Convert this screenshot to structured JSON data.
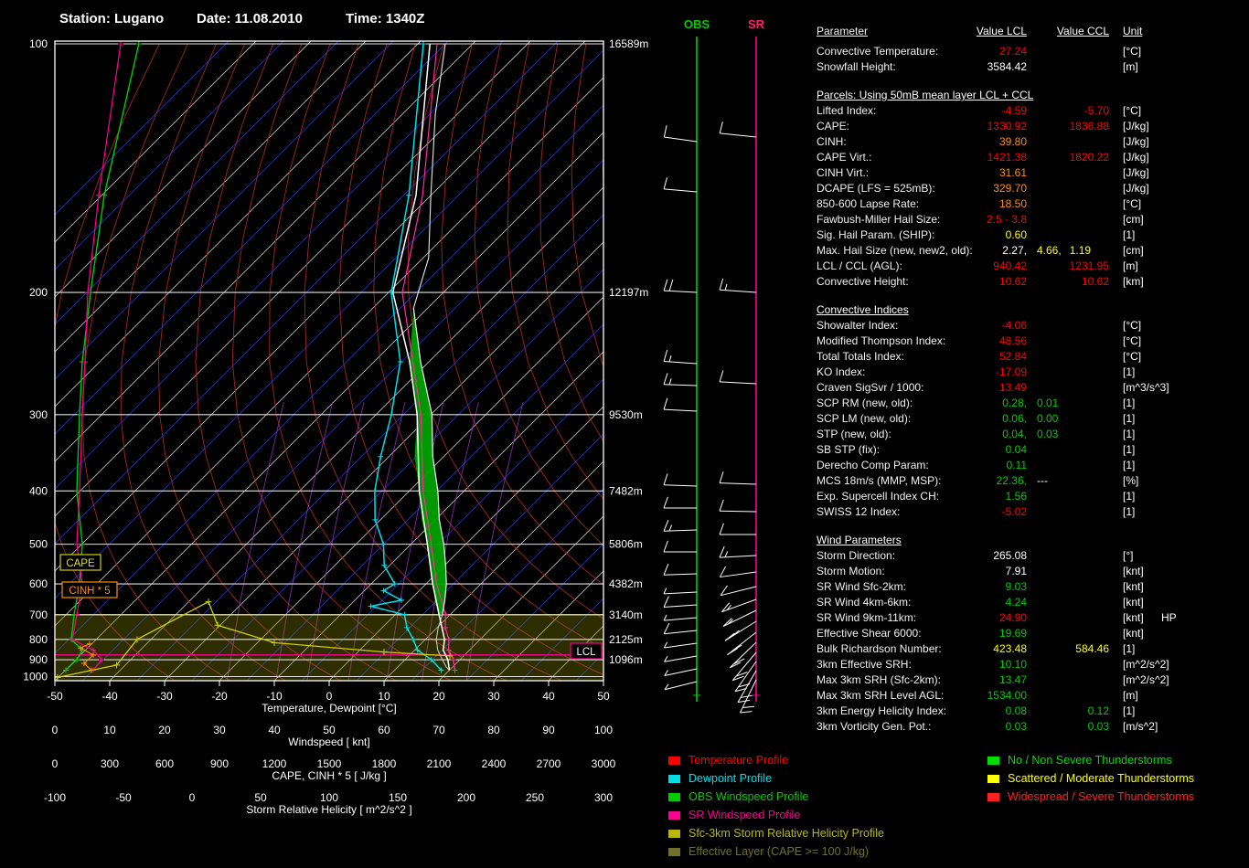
{
  "header": {
    "station": "Station: Lugano",
    "date": "Date: 11.08.2010",
    "time": "Time: 1340Z"
  },
  "obs_label": "OBS",
  "sr_label": "SR",
  "colors": {
    "red": "#ff0000",
    "orange": "#ff8c00",
    "yellow": "#ffff00",
    "green": "#00cc00",
    "white": "#ffffff",
    "cyan": "#00dde8",
    "magenta": "#ff0090",
    "lime": "#00cc00",
    "dark_yellow": "#b8b800",
    "olive": "#70702a"
  },
  "chart_data": {
    "type": "line",
    "title": "Skew-T log-P sounding",
    "pressure_ticks": [
      100,
      200,
      300,
      400,
      500,
      600,
      700,
      800,
      900,
      1000
    ],
    "height_labels": [
      "16589m",
      "12197m",
      "9530m",
      "7482m",
      "5806m",
      "4382m",
      "3140m",
      "2125m",
      "1096m"
    ],
    "temp_axis": {
      "label": "Temperature, Dewpoint [°C]",
      "ticks": [
        -50,
        -40,
        -30,
        -20,
        -10,
        0,
        10,
        20,
        30,
        40,
        50
      ],
      "range": [
        -50,
        50
      ]
    },
    "wind_axis": {
      "label": "Windspeed [ knt]",
      "ticks": [
        0,
        10,
        20,
        30,
        40,
        50,
        60,
        70,
        80,
        90,
        100
      ],
      "range": [
        0,
        100
      ]
    },
    "cape_axis": {
      "label": "CAPE, CINH * 5 [ J/kg ]",
      "ticks": [
        0,
        300,
        600,
        900,
        1200,
        1500,
        1800,
        2100,
        2400,
        2700,
        3000
      ],
      "range": [
        0,
        3000
      ]
    },
    "srh_axis": {
      "label": "Storm Relative Helicity [ m^2/s^2 ]",
      "ticks": [
        -100,
        -50,
        0,
        50,
        100,
        150,
        200,
        250,
        300
      ],
      "range": [
        -100,
        300
      ]
    },
    "labels": {
      "cape": "CAPE",
      "cinh": "CINH * 5",
      "lcl": "LCL"
    },
    "lcl_pressure": 875,
    "effective_layer": {
      "top_p": 700,
      "bottom_p": 1000
    },
    "mixing_ratio_tdew": [
      -18.6,
      -9.7,
      -4,
      3.5,
      10.5,
      16.9,
      25
    ],
    "series": {
      "temperature": [
        [
          960,
          20
        ],
        [
          900,
          17.8
        ],
        [
          850,
          15.2
        ],
        [
          800,
          13.5
        ],
        [
          700,
          8
        ],
        [
          600,
          1.2
        ],
        [
          500,
          -7
        ],
        [
          400,
          -18.2
        ],
        [
          300,
          -32.5
        ],
        [
          250,
          -43.5
        ],
        [
          200,
          -59.2
        ],
        [
          150,
          -72.7
        ],
        [
          100,
          -97.8
        ]
      ],
      "dewpoint": [
        [
          960,
          18.5
        ],
        [
          900,
          14.8
        ],
        [
          850,
          10.5
        ],
        [
          800,
          7.8
        ],
        [
          750,
          4.5
        ],
        [
          700,
          1.7
        ],
        [
          670,
          -6
        ],
        [
          650,
          -1.5
        ],
        [
          620,
          -6.5
        ],
        [
          600,
          -5.7
        ],
        [
          550,
          -11
        ],
        [
          500,
          -15
        ],
        [
          450,
          -21
        ],
        [
          400,
          -26.3
        ],
        [
          350,
          -31.5
        ],
        [
          300,
          -37.2
        ],
        [
          250,
          -45.2
        ],
        [
          200,
          -59.5
        ],
        [
          150,
          -74
        ],
        [
          100,
          -99
        ]
      ],
      "parcel": [
        [
          700,
          8.6
        ],
        [
          650,
          6.4
        ],
        [
          600,
          3.7
        ],
        [
          550,
          0.2
        ],
        [
          500,
          -4
        ],
        [
          450,
          -9.3
        ],
        [
          400,
          -14.8
        ],
        [
          350,
          -22
        ],
        [
          300,
          -29.8
        ],
        [
          250,
          -41.5
        ],
        [
          210,
          -52.6
        ]
      ],
      "environment_cape": [
        [
          210,
          -52.6
        ],
        [
          250,
          -43.5
        ],
        [
          300,
          -32.5
        ],
        [
          350,
          -25.3
        ],
        [
          400,
          -18.2
        ],
        [
          450,
          -12.5
        ],
        [
          500,
          -7
        ],
        [
          550,
          -2.7
        ],
        [
          600,
          1.2
        ],
        [
          650,
          4.6
        ],
        [
          700,
          8
        ]
      ],
      "parcel_below": [
        [
          960,
          20
        ],
        [
          940,
          18.8
        ],
        [
          900,
          16.8
        ],
        [
          850,
          14.2
        ],
        [
          800,
          12
        ],
        [
          750,
          10.2
        ],
        [
          700,
          8.6
        ]
      ],
      "parcel_above": [
        [
          210,
          -52.6
        ],
        [
          180,
          -59
        ],
        [
          150,
          -70
        ],
        [
          120,
          -84
        ],
        [
          100,
          -95
        ]
      ],
      "magenta_profile": [
        [
          960,
          21
        ],
        [
          900,
          18.8
        ],
        [
          850,
          16.2
        ],
        [
          800,
          14.3
        ],
        [
          750,
          11.5
        ],
        [
          700,
          9.2
        ],
        [
          600,
          1.9
        ],
        [
          500,
          -6.3
        ],
        [
          400,
          -17.5
        ],
        [
          300,
          -31.8
        ],
        [
          250,
          -42.9
        ],
        [
          200,
          -57.5
        ],
        [
          150,
          -71.5
        ],
        [
          100,
          -96.5
        ]
      ],
      "obs_windspeed": [
        [
          100,
          15.3
        ],
        [
          150,
          9
        ],
        [
          200,
          6.5
        ],
        [
          250,
          5
        ],
        [
          300,
          4.5
        ],
        [
          400,
          4
        ],
        [
          500,
          5
        ],
        [
          600,
          4.5
        ],
        [
          700,
          3.5
        ],
        [
          800,
          3
        ],
        [
          850,
          5
        ],
        [
          900,
          4
        ],
        [
          960,
          2
        ]
      ],
      "sr_windspeed": [
        [
          100,
          12
        ],
        [
          150,
          8
        ],
        [
          200,
          6
        ],
        [
          250,
          5.5
        ],
        [
          300,
          5
        ],
        [
          400,
          4.5
        ],
        [
          500,
          4
        ],
        [
          600,
          5
        ],
        [
          700,
          4
        ],
        [
          800,
          3.2
        ],
        [
          850,
          7
        ],
        [
          900,
          8.5
        ],
        [
          960,
          7
        ]
      ],
      "srh_profile": [
        [
          1005,
          -98
        ],
        [
          930,
          -55
        ],
        [
          800,
          -40
        ],
        [
          655,
          12
        ]
      ],
      "cape_profile": [
        [
          740,
          890
        ],
        [
          815,
          1200
        ],
        [
          860,
          1800
        ],
        [
          880,
          2160
        ]
      ],
      "cinh_profile": [
        [
          960,
          200
        ],
        [
          920,
          160
        ],
        [
          875,
          210
        ],
        [
          840,
          140
        ],
        [
          820,
          190
        ]
      ]
    }
  },
  "barbs": {
    "obs": [
      [
        155,
        8,
        1
      ],
      [
        210,
        5,
        1
      ],
      [
        320,
        3,
        2
      ],
      [
        398,
        4,
        1.5
      ],
      [
        422,
        2,
        1.5
      ],
      [
        450,
        3,
        1
      ],
      [
        532,
        2,
        1
      ],
      [
        556,
        0,
        1
      ],
      [
        580,
        -2,
        1.5
      ],
      [
        604,
        0,
        1
      ],
      [
        628,
        -2,
        1
      ],
      [
        648,
        -3,
        0.5
      ],
      [
        662,
        -4,
        1
      ],
      [
        676,
        -5,
        0.5
      ],
      [
        690,
        -6,
        1
      ],
      [
        704,
        -8,
        0.5
      ],
      [
        718,
        -10,
        0.5
      ],
      [
        732,
        -12,
        0.5
      ],
      [
        746,
        -14,
        0.5
      ]
    ],
    "sr": [
      [
        150,
        6,
        1
      ],
      [
        320,
        4,
        1.5
      ],
      [
        420,
        3,
        1
      ],
      [
        530,
        2,
        1
      ],
      [
        560,
        1,
        1
      ],
      [
        585,
        0,
        1
      ],
      [
        608,
        -3,
        1.5
      ],
      [
        626,
        -8,
        1
      ],
      [
        642,
        -14,
        1
      ],
      [
        656,
        -20,
        1.5
      ],
      [
        668,
        -26,
        1.5
      ],
      [
        680,
        -32,
        2
      ],
      [
        692,
        -38,
        2
      ],
      [
        703,
        -44,
        2
      ],
      [
        714,
        -50,
        2
      ],
      [
        724,
        -55,
        2
      ],
      [
        734,
        -60,
        2
      ],
      [
        744,
        -64,
        2
      ]
    ]
  },
  "table": {
    "headers": {
      "param": "Parameter",
      "lcl": "Value LCL",
      "ccl": "Value CCL",
      "unit": "Unit"
    },
    "rows": [
      {
        "l": "Convective Temperature:",
        "v1": [
          [
            "27.24",
            "r"
          ]
        ],
        "u": "[°C]"
      },
      {
        "l": "Snowfall Height:",
        "v1": [
          [
            "3584.42",
            "w"
          ]
        ],
        "u": "[m]"
      },
      {
        "t": "b"
      },
      {
        "t": "h",
        "l": "Parcels: Using 50mB mean layer LCL + CCL"
      },
      {
        "l": "Lifted Index:",
        "v1": [
          [
            "-4.59",
            "r"
          ]
        ],
        "v2": [
          [
            "-5.70",
            "r"
          ]
        ],
        "u": "[°C]"
      },
      {
        "l": "CAPE:",
        "v1": [
          [
            "1330.92",
            "r"
          ]
        ],
        "v2": [
          [
            "1836.88",
            "r"
          ]
        ],
        "u": "[J/kg]"
      },
      {
        "l": "CINH:",
        "v1": [
          [
            "39.80",
            "o"
          ]
        ],
        "u": "[J/kg]"
      },
      {
        "l": "CAPE Virt.:",
        "v1": [
          [
            "1421.38",
            "r"
          ]
        ],
        "v2": [
          [
            "1820.22",
            "r"
          ]
        ],
        "u": "[J/kg]"
      },
      {
        "l": "CINH Virt.:",
        "v1": [
          [
            "31.61",
            "o"
          ]
        ],
        "u": "[J/kg]"
      },
      {
        "l": "DCAPE (LFS = 525mB):",
        "v1": [
          [
            "329.70",
            "o"
          ]
        ],
        "u": "[J/kg]"
      },
      {
        "l": "850-600 Lapse Rate:",
        "v1": [
          [
            "18.50",
            "o"
          ]
        ],
        "u": "[°C]"
      },
      {
        "l": "Fawbush-Miller Hail Size:",
        "v1": [
          [
            "2.5 - 3.8",
            "r"
          ]
        ],
        "u": "[cm]"
      },
      {
        "l": "Sig. Hail Param. (SHIP):",
        "v1": [
          [
            "0.60",
            "y"
          ]
        ],
        "u": "[1]"
      },
      {
        "l": "Max. Hail Size (new, new2, old):",
        "v1": [
          [
            "2.27,",
            "w"
          ]
        ],
        "ix": [
          [
            "4.66,",
            "y"
          ],
          [
            "1.19",
            "y"
          ]
        ],
        "u": "[cm]"
      },
      {
        "l": "LCL / CCL (AGL):",
        "v1": [
          [
            "940.42",
            "r"
          ]
        ],
        "v2": [
          [
            "1231.95",
            "r"
          ]
        ],
        "u": "[m]"
      },
      {
        "l": "Convective Height:",
        "v1": [
          [
            "10.62",
            "r"
          ]
        ],
        "v2": [
          [
            "10.62",
            "r"
          ]
        ],
        "u": "[km]"
      },
      {
        "t": "b"
      },
      {
        "t": "h",
        "l": "Convective Indices"
      },
      {
        "l": "Showalter Index:",
        "v1": [
          [
            "-4.06",
            "r"
          ]
        ],
        "u": "[°C]"
      },
      {
        "l": "Modified Thompson Index:",
        "v1": [
          [
            "48.56",
            "r"
          ]
        ],
        "u": "[°C]"
      },
      {
        "l": "Total Totals Index:",
        "v1": [
          [
            "52.84",
            "r"
          ]
        ],
        "u": "[°C]"
      },
      {
        "l": "KO Index:",
        "v1": [
          [
            "-17.09",
            "r"
          ]
        ],
        "u": "[1]"
      },
      {
        "l": "Craven SigSvr / 1000:",
        "v1": [
          [
            "13.49",
            "r"
          ]
        ],
        "u": "[m^3/s^3]"
      },
      {
        "l": "SCP RM (new, old):",
        "v1": [
          [
            "0.28,",
            "g"
          ]
        ],
        "ix": [
          [
            "0.01",
            "g"
          ]
        ],
        "u": "[1]"
      },
      {
        "l": "SCP LM (new, old):",
        "v1": [
          [
            "0.06,",
            "g"
          ]
        ],
        "ix": [
          [
            "0.00",
            "g"
          ]
        ],
        "u": "[1]"
      },
      {
        "l": "STP (new, old):",
        "v1": [
          [
            "0.04,",
            "g"
          ]
        ],
        "ix": [
          [
            "0.03",
            "g"
          ]
        ],
        "u": "[1]"
      },
      {
        "l": "SB STP (fix):",
        "v1": [
          [
            "0.04",
            "g"
          ]
        ],
        "u": "[1]"
      },
      {
        "l": "Derecho Comp Param:",
        "v1": [
          [
            "0.11",
            "g"
          ]
        ],
        "u": "[1]"
      },
      {
        "l": "MCS 18m/s (MMP, MSP):",
        "v1": [
          [
            "22.36,",
            "g"
          ]
        ],
        "ix": [
          [
            "---",
            "w"
          ]
        ],
        "u": "[%]"
      },
      {
        "l": "Exp. Supercell Index CH:",
        "v1": [
          [
            "1.56",
            "g"
          ]
        ],
        "u": "[1]"
      },
      {
        "l": "SWISS 12 Index:",
        "v1": [
          [
            "-5.02",
            "r"
          ]
        ],
        "u": "[1]"
      },
      {
        "t": "b"
      },
      {
        "t": "h",
        "l": "Wind Parameters"
      },
      {
        "l": "Storm Direction:",
        "v1": [
          [
            "265.08",
            "w"
          ]
        ],
        "u": "[°]"
      },
      {
        "l": "Storm Motion:",
        "v1": [
          [
            "7.91",
            "w"
          ]
        ],
        "u": "[knt]"
      },
      {
        "l": "SR Wind Sfc-2km:",
        "v1": [
          [
            "9.03",
            "g"
          ]
        ],
        "u": "[knt]"
      },
      {
        "l": "SR Wind 4km-6km:",
        "v1": [
          [
            "4.24",
            "g"
          ]
        ],
        "u": "[knt]"
      },
      {
        "l": "SR Wind 9km-11km:",
        "v1": [
          [
            "24.90",
            "r"
          ]
        ],
        "u": "[knt]",
        "sx": "HP"
      },
      {
        "l": "Effective Shear 6000:",
        "v1": [
          [
            "19.69",
            "g"
          ]
        ],
        "u": "[knt]"
      },
      {
        "l": "Bulk Richardson Number:",
        "v1": [
          [
            "423.48",
            "y"
          ]
        ],
        "v2": [
          [
            "584.46",
            "y"
          ]
        ],
        "u": "[1]"
      },
      {
        "l": "3km Effective SRH:",
        "v1": [
          [
            "10.10",
            "g"
          ]
        ],
        "u": "[m^2/s^2]"
      },
      {
        "l": "Max 3km SRH (Sfc-2km):",
        "v1": [
          [
            "13.47",
            "g"
          ]
        ],
        "u": "[m^2/s^2]"
      },
      {
        "l": "Max 3km SRH Level AGL:",
        "v1": [
          [
            "1534.00",
            "g"
          ]
        ],
        "u": "[m]"
      },
      {
        "l": "3km Energy Helicity Index:",
        "v1": [
          [
            "0.08",
            "g"
          ]
        ],
        "v2": [
          [
            "0.12",
            "g"
          ]
        ],
        "u": "[1]"
      },
      {
        "l": "3km Vorticity Gen. Pot.:",
        "v1": [
          [
            "0.03",
            "g"
          ]
        ],
        "v2": [
          [
            "0.03",
            "g"
          ]
        ],
        "u": "[m/s^2]"
      }
    ]
  },
  "legend_profiles": [
    {
      "label": "Temperature Profile",
      "color": "#ff0000"
    },
    {
      "label": "Dewpoint Profile",
      "color": "#00dde8"
    },
    {
      "label": "OBS Windspeed Profile",
      "color": "#00cc00"
    },
    {
      "label": "SR Windspeed Profile",
      "color": "#ff0090"
    },
    {
      "label": "Sfc-3km Storm Relative Helicity Profile",
      "color": "#b8b800"
    },
    {
      "label": "Effective Layer (CAPE >= 100 J/kg)",
      "color": "#70702a"
    }
  ],
  "legend_severity": [
    {
      "label": "No / Non Severe Thunderstorms",
      "color": "#00dd00"
    },
    {
      "label": "Scattered / Moderate Thunderstorms",
      "color": "#ffff00"
    },
    {
      "label": "Widespread / Severe Thunderstorms",
      "color": "#ff2020"
    }
  ]
}
